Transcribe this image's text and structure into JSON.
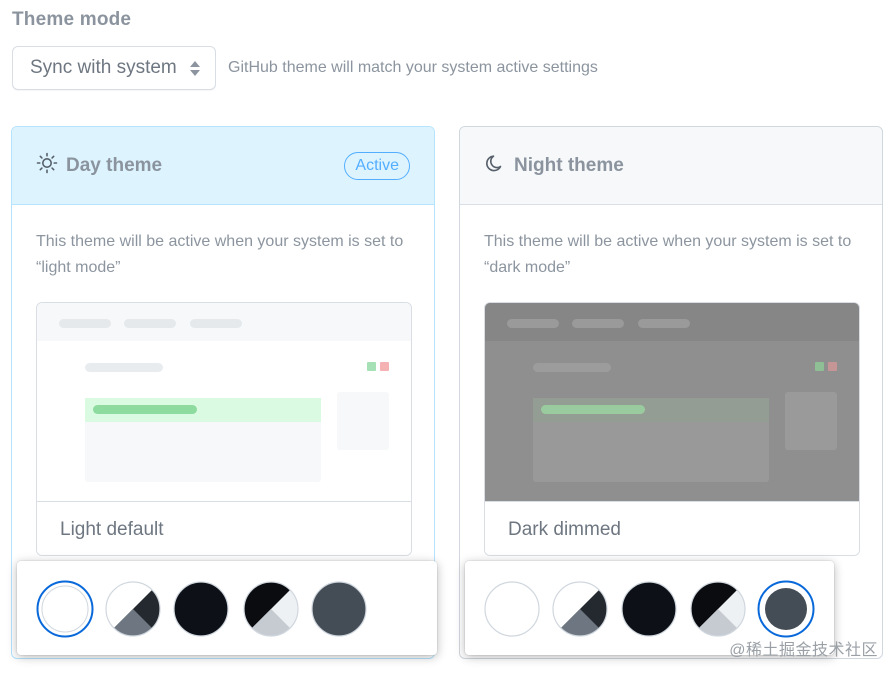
{
  "theme_mode": {
    "title": "Theme mode",
    "select_value": "Sync with system",
    "hint": "GitHub theme will match your system active settings"
  },
  "day": {
    "title": "Day theme",
    "badge": "Active",
    "description": "This theme will be active when your system is set to “light mode”",
    "preview_name": "Light default",
    "swatches": [
      "light-default",
      "light-high-contrast",
      "dark-default",
      "dark-high-contrast",
      "dark-dimmed"
    ],
    "selected": "light-default"
  },
  "night": {
    "title": "Night theme",
    "description": "This theme will be active when your system is set to “dark mode”",
    "preview_name": "Dark dimmed",
    "swatches": [
      "light-default",
      "light-high-contrast",
      "dark-default",
      "dark-high-contrast",
      "dark-dimmed"
    ],
    "selected": "dark-dimmed"
  },
  "icons": {
    "day": "sun-icon",
    "night": "moon-icon",
    "select": "select-arrows-icon"
  },
  "colors": {
    "accent": "#0969da",
    "active_bg": "#ddf4ff",
    "active_border": "#54aeff"
  },
  "watermark": "@稀土掘金技术社区"
}
